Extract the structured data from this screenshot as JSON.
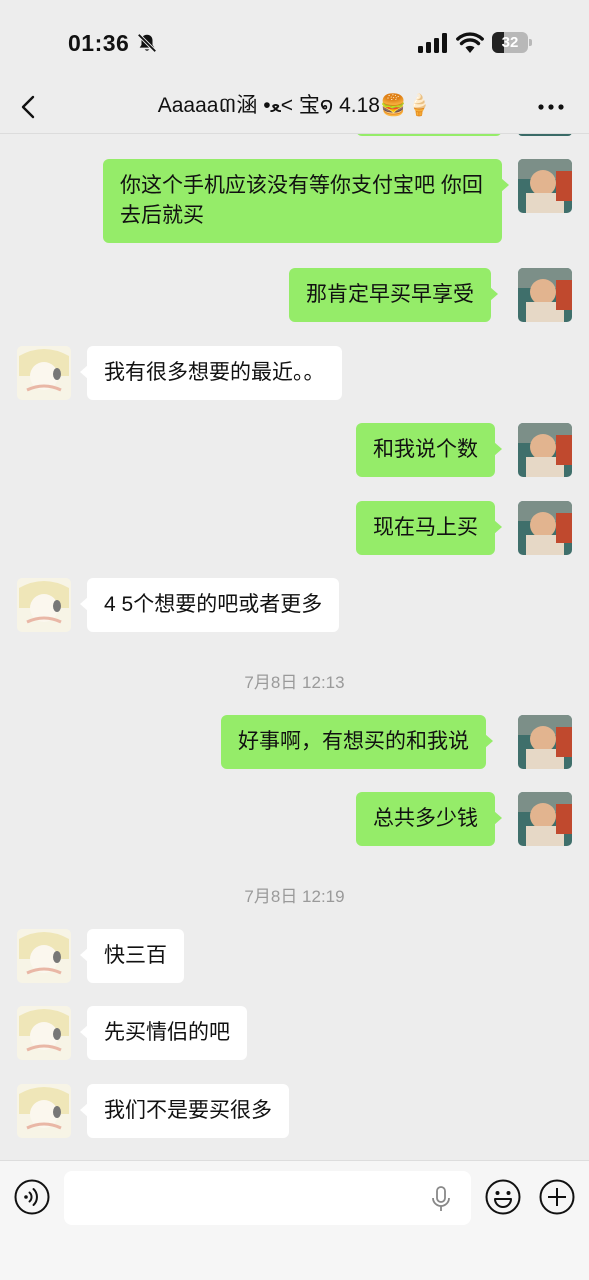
{
  "status_bar": {
    "time": "01:36",
    "battery": "32"
  },
  "header": {
    "title": "Aaaaa៣涵 •ﻌ< 宝໑ 4.18🍔🍦"
  },
  "messages": [
    {
      "sender": "me",
      "text": "你这个手机应该没有等你支付宝吧 你回去后就买"
    },
    {
      "sender": "me",
      "text": "那肯定早买早享受"
    },
    {
      "sender": "other",
      "text": "我有很多想要的最近。。"
    },
    {
      "sender": "me",
      "text": "和我说个数"
    },
    {
      "sender": "me",
      "text": "现在马上买"
    },
    {
      "sender": "other",
      "text": "4 5个想要的吧或者更多"
    },
    {
      "sender": "me",
      "text": "好事啊，有想买的和我说"
    },
    {
      "sender": "me",
      "text": "总共多少钱"
    },
    {
      "sender": "other",
      "text": "快三百"
    },
    {
      "sender": "other",
      "text": "先买情侣的吧"
    },
    {
      "sender": "other",
      "text": "我们不是要买很多"
    }
  ],
  "timestamps": [
    "7月8日 12:13",
    "7月8日 12:19"
  ],
  "input": {
    "value": "",
    "placeholder": ""
  },
  "colors": {
    "my_bubble": "#95ec69",
    "their_bubble": "#ffffff",
    "background": "#ededed"
  },
  "icons": {
    "back": "chevron-left-icon",
    "more": "more-dots-icon",
    "voice": "voice-icon",
    "mic": "mic-icon",
    "emoji": "emoji-icon",
    "plus": "plus-icon"
  }
}
